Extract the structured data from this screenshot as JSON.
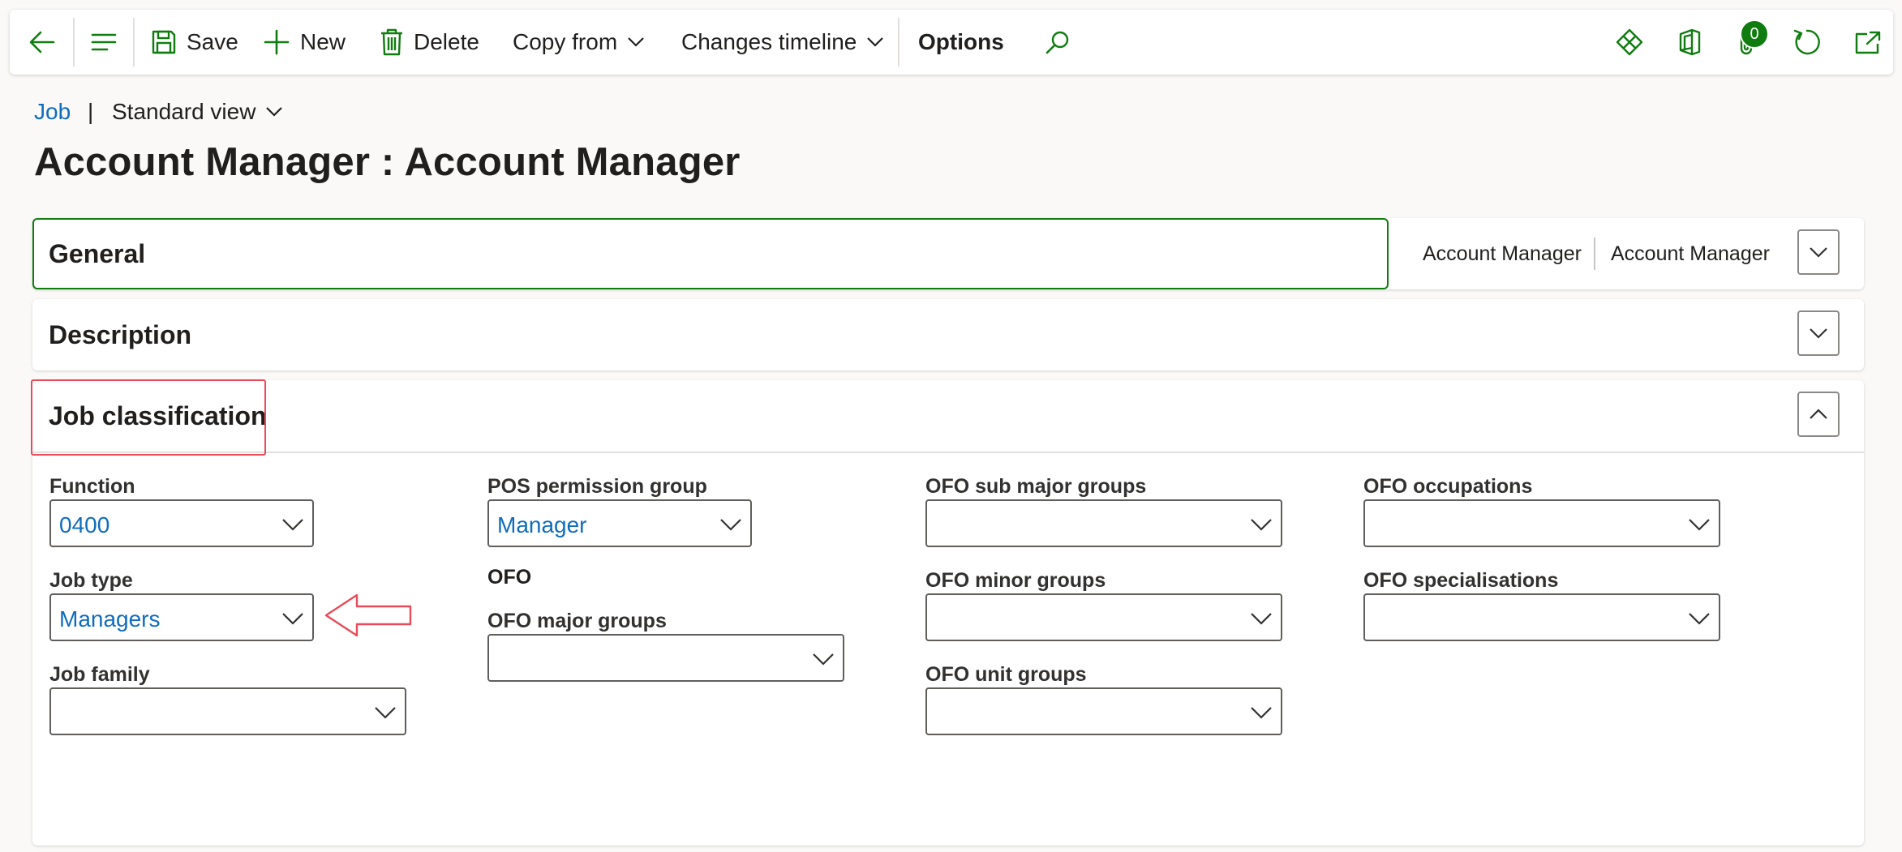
{
  "toolbar": {
    "back_icon": "back-arrow-icon",
    "menu_icon": "hamburger-icon",
    "save_label": "Save",
    "new_label": "New",
    "delete_label": "Delete",
    "copy_from_label": "Copy from",
    "changes_timeline_label": "Changes timeline",
    "options_label": "Options",
    "search_icon": "search-icon",
    "right_icons": [
      "power-apps-icon",
      "office-icon",
      "attachments-icon",
      "refresh-icon",
      "open-new-window-icon"
    ],
    "attachments_count": "0"
  },
  "breadcrumb": {
    "link": "Job",
    "separator": "|",
    "view": "Standard view"
  },
  "page_title": "Account Manager : Account Manager",
  "fasttabs": {
    "general": {
      "title": "General",
      "summary": [
        "Account Manager",
        "Account Manager"
      ]
    },
    "description": {
      "title": "Description"
    },
    "job_classification": {
      "title": "Job classification",
      "fields": {
        "function": {
          "label": "Function",
          "value": "0400"
        },
        "job_type": {
          "label": "Job type",
          "value": "Managers"
        },
        "job_family": {
          "label": "Job family",
          "value": ""
        },
        "pos_permission_group": {
          "label": "POS permission group",
          "value": "Manager"
        },
        "ofo_heading": "OFO",
        "ofo_major_groups": {
          "label": "OFO major groups",
          "value": ""
        },
        "ofo_sub_major_groups": {
          "label": "OFO sub major groups",
          "value": ""
        },
        "ofo_minor_groups": {
          "label": "OFO minor groups",
          "value": ""
        },
        "ofo_unit_groups": {
          "label": "OFO unit groups",
          "value": ""
        },
        "ofo_occupations": {
          "label": "OFO occupations",
          "value": ""
        },
        "ofo_specialisations": {
          "label": "OFO specialisations",
          "value": ""
        }
      }
    }
  },
  "colors": {
    "accent_green": "#107c10",
    "link_blue": "#0f6cbd",
    "annotation_red": "#e94b5a"
  }
}
